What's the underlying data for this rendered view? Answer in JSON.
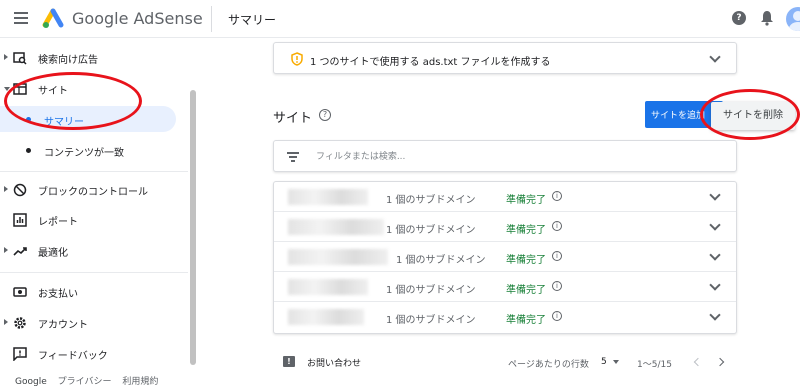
{
  "header": {
    "app_name_google": "Google",
    "app_name_product": "AdSense",
    "page_title": "サマリー"
  },
  "sidebar": {
    "items": [
      {
        "label": "検索向け広告",
        "icon": "search-ads-icon",
        "expandable": true
      },
      {
        "label": "サイト",
        "icon": "web-icon",
        "expanded": true
      },
      {
        "label": "サマリー",
        "active": true
      },
      {
        "label": "コンテンツが一致"
      },
      {
        "label": "ブロックのコントロール",
        "icon": "block-icon",
        "expandable": true
      },
      {
        "label": "レポート",
        "icon": "reports-icon"
      },
      {
        "label": "最適化",
        "icon": "trending-icon",
        "expandable": true
      },
      {
        "label": "お支払い",
        "icon": "payments-icon"
      },
      {
        "label": "アカウント",
        "icon": "gear-icon",
        "expandable": true
      },
      {
        "label": "フィードバック",
        "icon": "feedback-icon"
      }
    ],
    "footer": {
      "google": "Google",
      "privacy": "プライバシー",
      "terms": "利用規約"
    }
  },
  "main": {
    "ads_notice": "1 つのサイトで使用する ads.txt ファイルを作成する",
    "sites_title": "サイト",
    "add_site_button": "サイトを追加",
    "delete_site_button": "サイトを削除",
    "filter_placeholder": "フィルタまたは検索...",
    "rows": [
      {
        "subdomains": "1 個のサブドメイン",
        "status": "準備完了"
      },
      {
        "subdomains": "1 個のサブドメイン",
        "status": "準備完了"
      },
      {
        "subdomains": "1 個のサブドメイン",
        "status": "準備完了"
      },
      {
        "subdomains": "1 個のサブドメイン",
        "status": "準備完了"
      },
      {
        "subdomains": "1 個のサブドメイン",
        "status": "準備完了"
      }
    ],
    "footer": {
      "contact": "お問い合わせ",
      "rows_per_page_label": "ページあたりの行数",
      "rows_per_page_value": "5",
      "range": "1～5/15"
    }
  },
  "colors": {
    "accent_blue": "#1a73e8",
    "status_green": "#188038",
    "annotation_red": "#e8131b"
  }
}
